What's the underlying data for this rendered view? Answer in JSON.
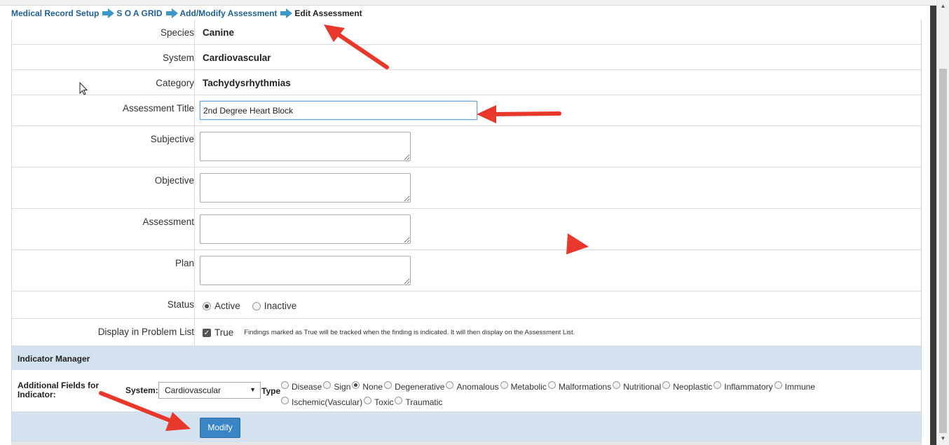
{
  "breadcrumb": {
    "item1": "Medical Record Setup",
    "item2": "S O A GRID",
    "item3": "Add/Modify Assessment",
    "current": "Edit Assessment"
  },
  "form": {
    "species_label": "Species",
    "species_value": "Canine",
    "system_label": "System",
    "system_value": "Cardiovascular",
    "category_label": "Category",
    "category_value": "Tachydysrhythmias",
    "title_label": "Assessment Title",
    "title_value": "2nd Degree Heart Block",
    "subjective_label": "Subjective",
    "objective_label": "Objective",
    "assessment_label": "Assessment",
    "plan_label": "Plan",
    "status_label": "Status",
    "status_active": "Active",
    "status_inactive": "Inactive",
    "display_label": "Display in Problem List",
    "display_true": "True",
    "display_note": "Findings marked as True will be tracked when the finding is indicated. It will then display on the Assessment List."
  },
  "indicator": {
    "header": "Indicator Manager",
    "additional_fields": "Additional Fields for Indicator:",
    "system_label": "System:",
    "system_selected": "Cardiovascular",
    "type_label": "Type",
    "types": [
      "Disease",
      "Sign",
      "None",
      "Degenerative",
      "Anomalous",
      "Metabolic",
      "Malformations",
      "Nutritional",
      "Neoplastic",
      "Inflammatory",
      "Immune",
      "Ischemic(Vascular)",
      "Toxic",
      "Traumatic"
    ],
    "selected_type": "None"
  },
  "actions": {
    "modify": "Modify"
  },
  "colors": {
    "link": "#1f5f94",
    "section_bg": "#d3e2ee",
    "button": "#3a85c6",
    "annotation_arrow": "#e8382b"
  }
}
